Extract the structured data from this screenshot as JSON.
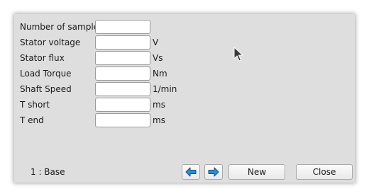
{
  "form": {
    "fields": [
      {
        "label": "Number of samples",
        "value": "",
        "unit": ""
      },
      {
        "label": "Stator voltage",
        "value": "",
        "unit": "V"
      },
      {
        "label": "Stator flux",
        "value": "",
        "unit": "Vs"
      },
      {
        "label": "Load Torque",
        "value": "",
        "unit": "Nm"
      },
      {
        "label": "Shaft Speed",
        "value": "",
        "unit": "1/min"
      },
      {
        "label": "T short",
        "value": "",
        "unit": "ms"
      },
      {
        "label": "T end",
        "value": "",
        "unit": "ms"
      }
    ]
  },
  "footer": {
    "status": "1 : Base",
    "prev_icon": "arrow-left-icon",
    "next_icon": "arrow-right-icon",
    "new_label": "New",
    "close_label": "Close"
  },
  "colors": {
    "dialog_bg": "#dedede",
    "arrow_fill": "#2a8fd6",
    "arrow_stroke": "#0f4f8a"
  }
}
